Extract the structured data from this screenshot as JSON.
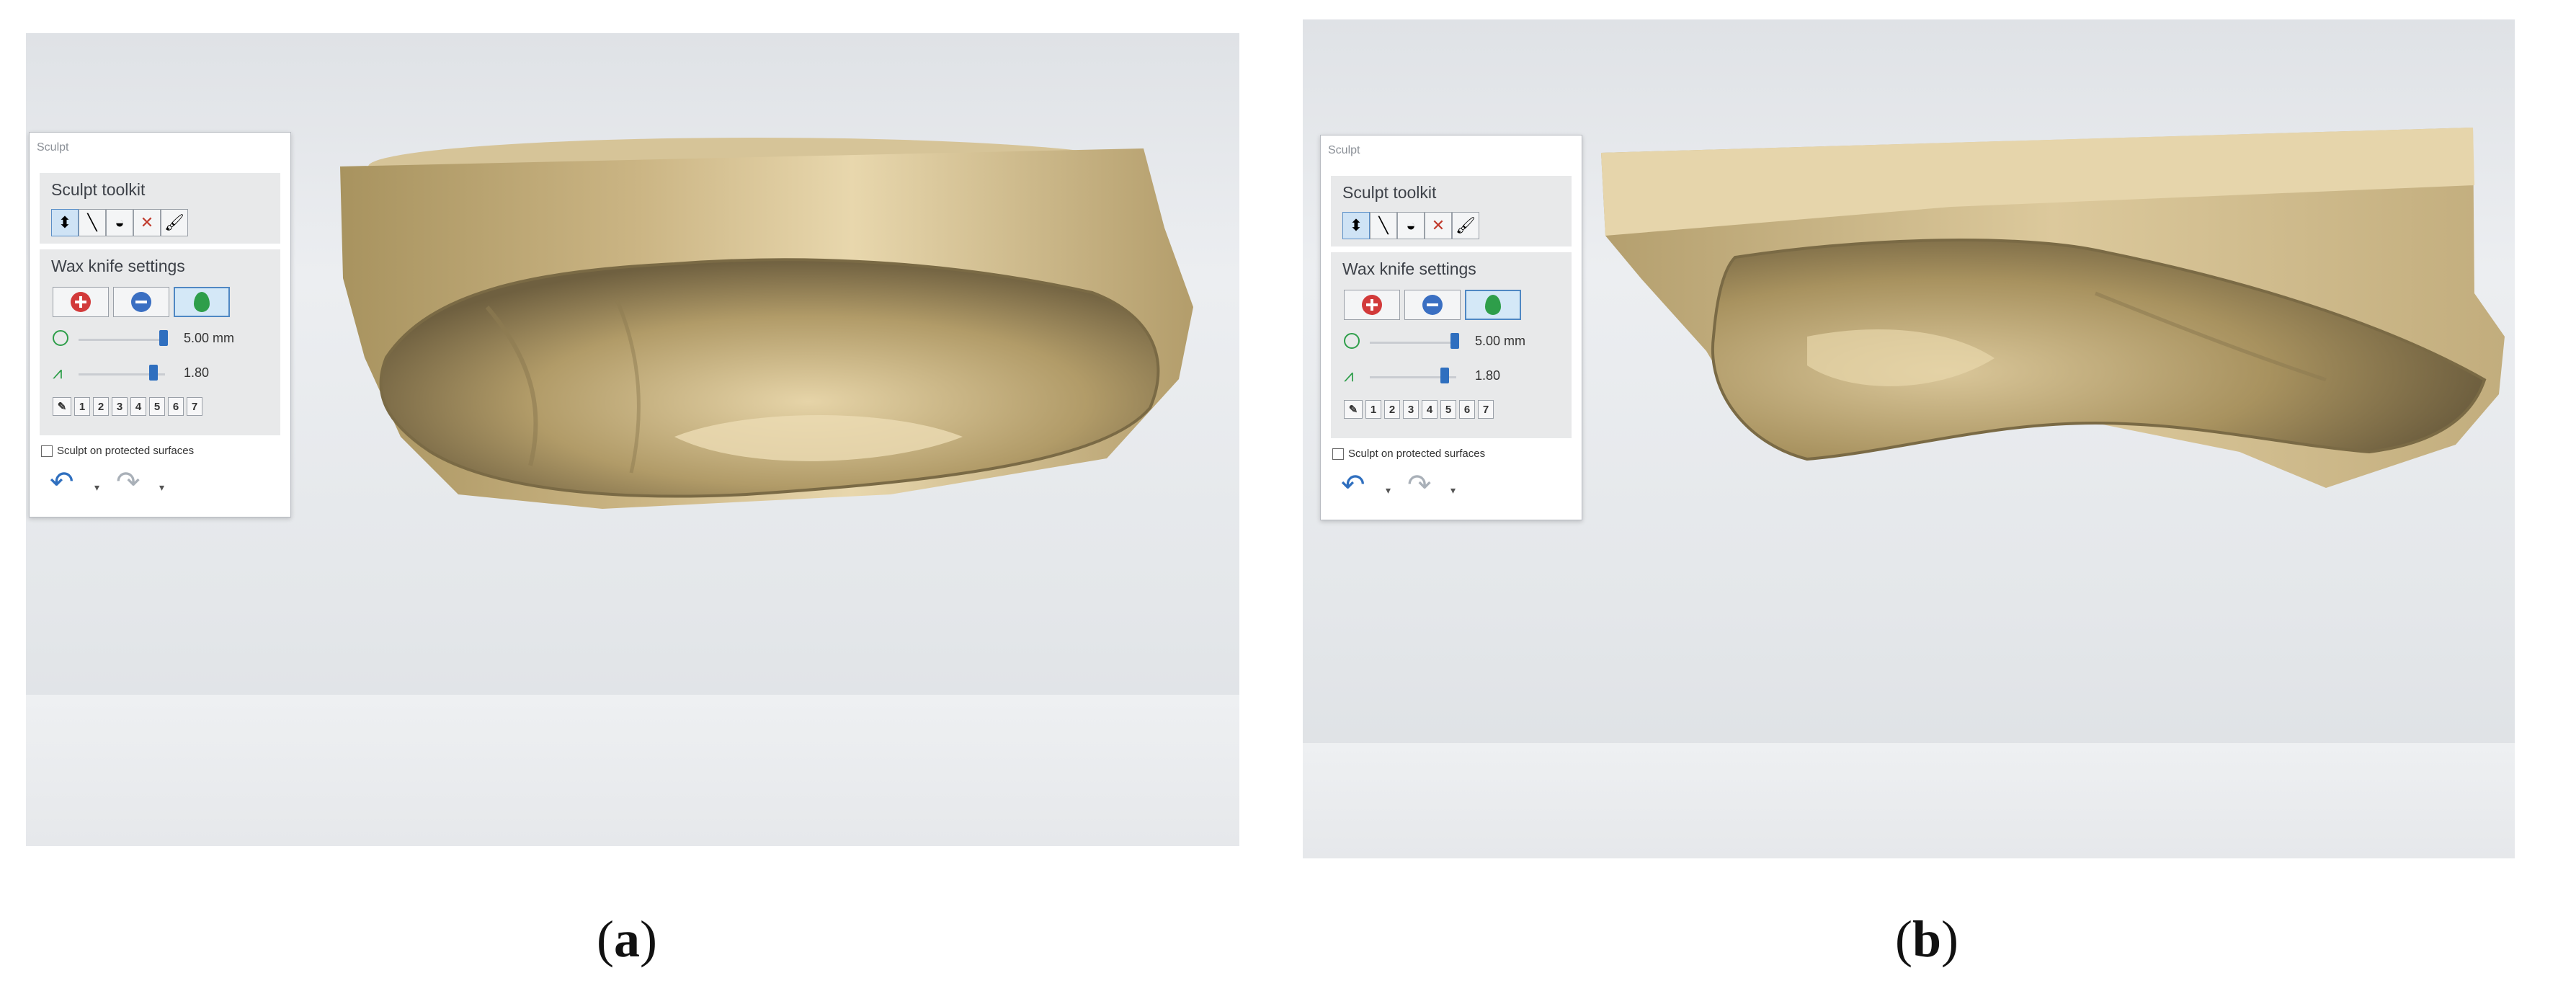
{
  "panels": [
    {
      "caption": "a",
      "dialog": {
        "title": "Sculpt",
        "toolkit_header": "Sculpt toolkit",
        "settings_header": "Wax knife settings",
        "size_value": "5.00 mm",
        "strength_value": "1.80",
        "presets": [
          "1",
          "2",
          "3",
          "4",
          "5",
          "6",
          "7"
        ],
        "checkbox_label": "Sculpt on protected surfaces"
      }
    },
    {
      "caption": "b",
      "dialog": {
        "title": "Sculpt",
        "toolkit_header": "Sculpt toolkit",
        "settings_header": "Wax knife settings",
        "size_value": "5.00 mm",
        "strength_value": "1.80",
        "presets": [
          "1",
          "2",
          "3",
          "4",
          "5",
          "6",
          "7"
        ],
        "checkbox_label": "Sculpt on protected surfaces"
      }
    }
  ],
  "colors": {
    "model": "#c9b487",
    "model_dark": "#8e7b52",
    "accent": "#2f6fbf",
    "add_red": "#d23a3a",
    "smooth_green": "#2e9e4a"
  },
  "icons": [
    "select-tool-icon",
    "wax-knife-icon",
    "morph-icon",
    "delete-icon",
    "brush-icon",
    "add-material-icon",
    "remove-material-icon",
    "smooth-material-icon",
    "size-icon",
    "strength-icon",
    "preset-icon",
    "undo-icon",
    "redo-icon"
  ]
}
